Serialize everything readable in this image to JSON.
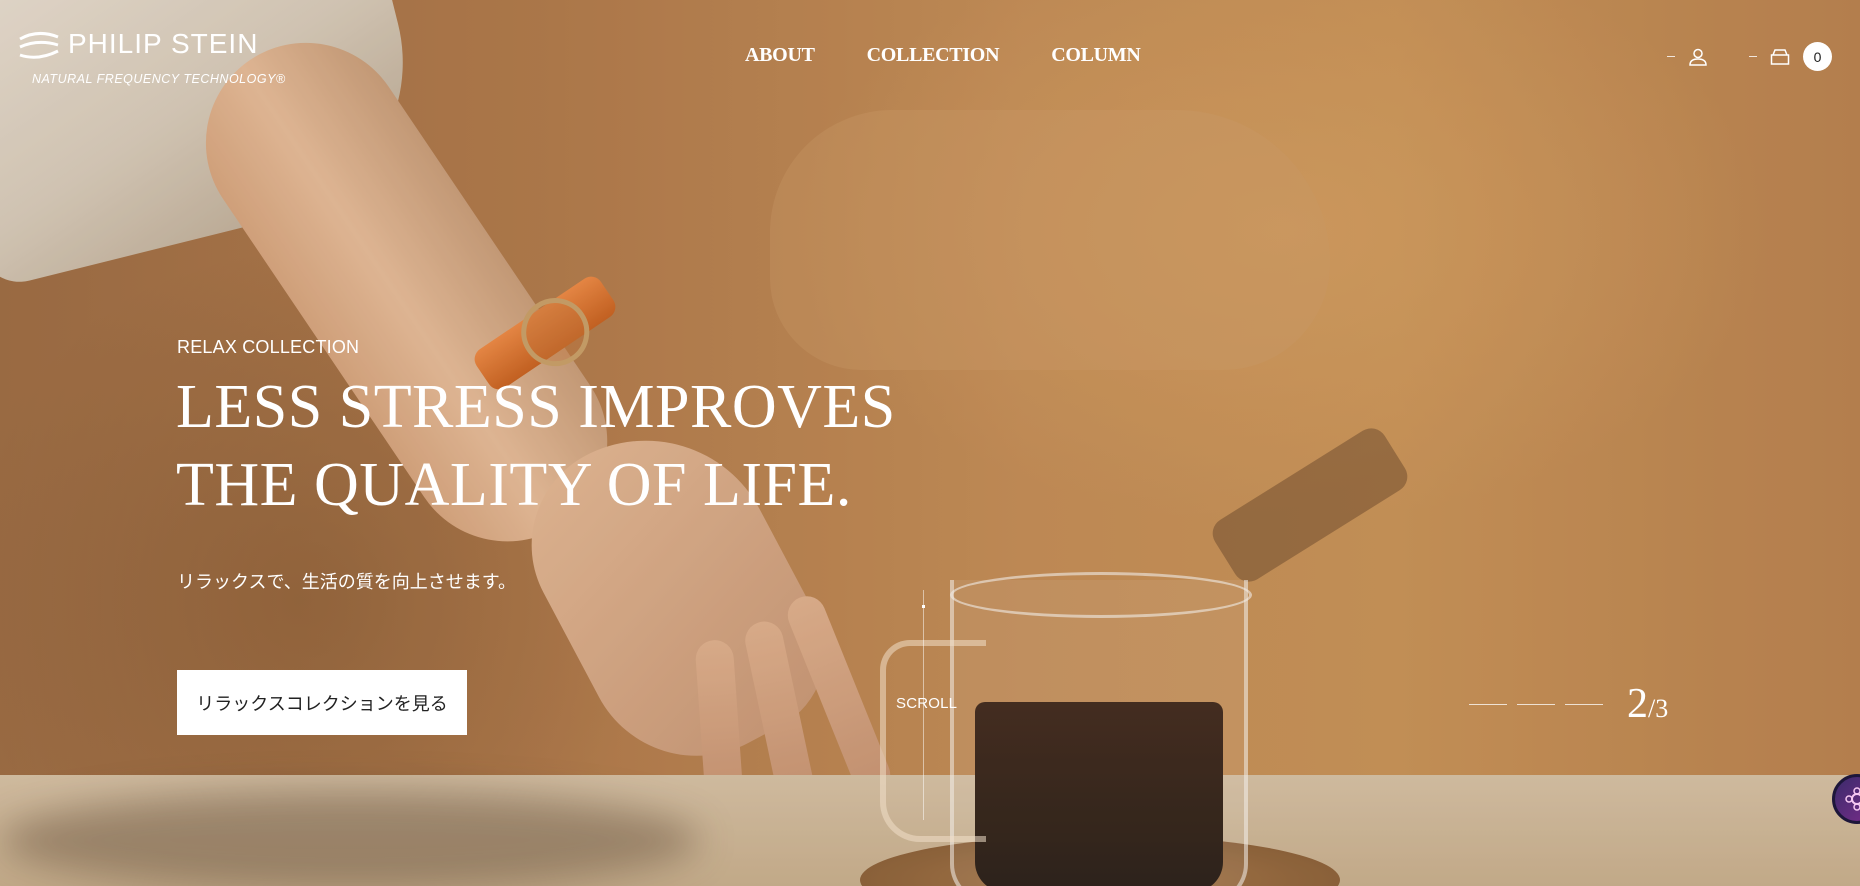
{
  "brand": {
    "name": "PHILIP STEIN",
    "tagline": "NATURAL FREQUENCY TECHNOLOGY®"
  },
  "nav": {
    "items": [
      {
        "label": "ABOUT"
      },
      {
        "label": "COLLECTION"
      },
      {
        "label": "COLUMN"
      }
    ]
  },
  "header_tools": {
    "account_icon": "user-icon",
    "cart_icon": "cart-icon",
    "cart_count": "0"
  },
  "hero": {
    "subtitle": "RELAX COLLECTION",
    "title_line1": "LESS STRESS IMPROVES",
    "title_line2": "THE QUALITY OF LIFE.",
    "description": "リラックスで、生活の質を向上させます。",
    "cta_label": "リラックスコレクションを見る"
  },
  "scroll": {
    "label": "SCROLL"
  },
  "slider": {
    "current": "2",
    "separator": "/",
    "total": "3"
  },
  "colors": {
    "accent": "#ffffff",
    "background": "#b9834f",
    "button_bg": "#ffffff",
    "button_text": "#222222"
  }
}
